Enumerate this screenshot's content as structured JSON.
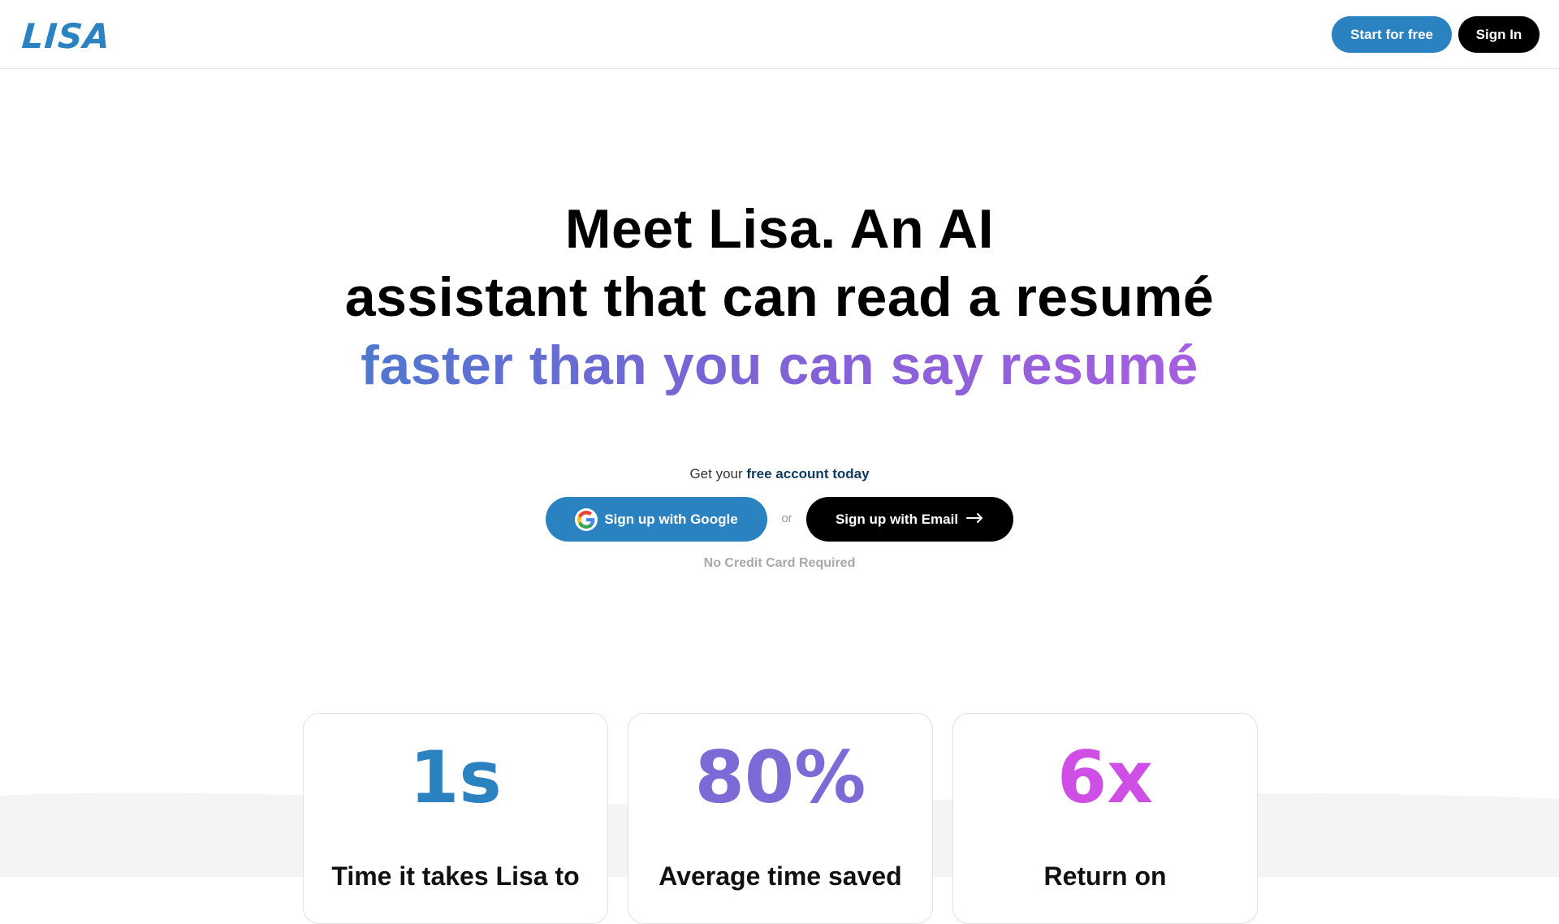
{
  "header": {
    "logo_text": "LISA",
    "start_label": "Start for free",
    "signin_label": "Sign In"
  },
  "hero": {
    "line1": "Meet Lisa. An AI",
    "line2": "assistant that can read a resumé",
    "line3": "faster than you can say resumé"
  },
  "cta": {
    "label_prefix": "Get your",
    "label_bold": "free account today",
    "google_label": "Sign up with Google",
    "or_label": "or",
    "email_label": "Sign up with Email",
    "note": "No Credit Card Required"
  },
  "stats": [
    {
      "value": "1s",
      "label": "Time it takes Lisa to",
      "color": "#2b82c1"
    },
    {
      "value": "80%",
      "label": "Average time saved",
      "color": "#7e6ad6"
    },
    {
      "value": "6x",
      "label": "Return on",
      "color": "#cf4fe6"
    }
  ],
  "colors": {
    "brand_blue": "#2b82c1",
    "black": "#000000",
    "gradient_start": "#4f78cf",
    "gradient_end": "#a65fe0"
  },
  "icons": {
    "google": "google-g-icon",
    "arrow": "arrow-right-icon"
  }
}
